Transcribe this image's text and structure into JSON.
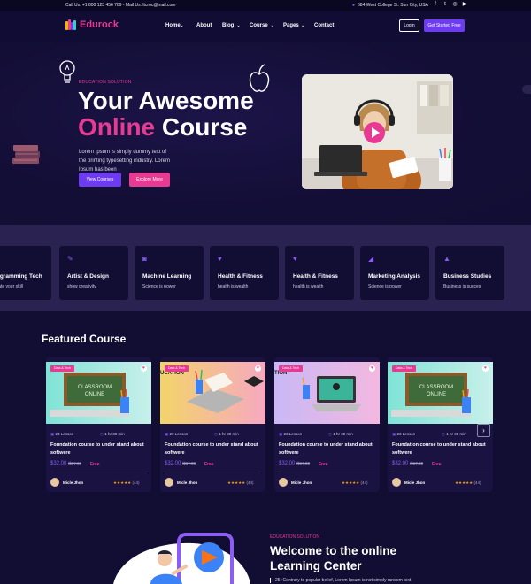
{
  "topbar": {
    "contact": "Call Us: +1 800 123 456 789 - Mail Us: ltcroc@mail.com",
    "address": "684 West College St. Sun City, USA",
    "social_icons": [
      "facebook-icon",
      "twitter-icon",
      "instagram-icon",
      "youtube-icon"
    ]
  },
  "header": {
    "logo_text": "Edurock",
    "nav": [
      "Home",
      "About",
      "Blog",
      "Course",
      "Pages",
      "Contact"
    ],
    "nav_dropdown": [
      true,
      false,
      true,
      true,
      true,
      false
    ],
    "login_label": "Login",
    "cta_label": "Get Started Free"
  },
  "hero": {
    "eyebrow": "EDUCATION SOLUTION",
    "title_line1": "Your Awesome",
    "title_pink": "Online",
    "title_rest": " Course",
    "description": "Lorem Ipsum is simply dummy text of the printing typesetting industry. Lorem Ipsum has been",
    "primary_button": "View Courses",
    "secondary_button": "Explore More"
  },
  "categories": [
    {
      "title": "Programming Tech",
      "subtitle": "Update your skill",
      "icon": "code-icon"
    },
    {
      "title": "Artist & Design",
      "subtitle": "show creativity",
      "icon": "brush-icon"
    },
    {
      "title": "Machine Learning",
      "subtitle": "Science is power",
      "icon": "robot-icon"
    },
    {
      "title": "Health & Fitness",
      "subtitle": "health is wealth",
      "icon": "heart-pulse-icon"
    },
    {
      "title": "Health & Fitness",
      "subtitle": "health is wealth",
      "icon": "heart-pulse-icon"
    },
    {
      "title": "Marketing Analysis",
      "subtitle": "Science is power",
      "icon": "megaphone-icon"
    },
    {
      "title": "Business Studies",
      "subtitle": "Business is succes",
      "icon": "chart-icon"
    }
  ],
  "featured": {
    "title": "Featured Course",
    "cards": [
      {
        "badge": "Data & Tech",
        "lessons": "23 Lesson",
        "duration": "1 hr 30 min",
        "title": "Foundation course to under stand about softwere",
        "price": "$32.00",
        "old_price": "/$67.00",
        "free": "Free",
        "author": "Micle Jhon",
        "rating_count": "(44)",
        "thumb": "classroom-online"
      },
      {
        "badge": "Data & Tech",
        "lessons": "23 Lesson",
        "duration": "1 hr 30 min",
        "title": "Foundation course to under stand about softwere",
        "price": "$32.00",
        "old_price": "/$67.00",
        "free": "Free",
        "author": "Micle Jhon",
        "rating_count": "(44)",
        "thumb": "education-book"
      },
      {
        "badge": "Data & Tech",
        "lessons": "23 Lesson",
        "duration": "1 hr 30 min",
        "title": "Foundation course to under stand about softwere",
        "price": "$32.00",
        "old_price": "/$67.00",
        "free": "Free",
        "author": "Micle Jhon",
        "rating_count": "(44)",
        "thumb": "education-laptop"
      },
      {
        "badge": "Data & Tech",
        "lessons": "23 Lesson",
        "duration": "1 hr 30 min",
        "title": "Foundation course to under stand about softwere",
        "price": "$32.00",
        "old_price": "/$67.00",
        "free": "Free",
        "author": "Micle Jhon",
        "rating_count": "(44)",
        "thumb": "classroom-online"
      }
    ],
    "thumb_words": {
      "classroom": "CLASSROOM ONLINE",
      "education": "UCATION",
      "education2": "TION"
    }
  },
  "welcome": {
    "eyebrow": "EDUCATION SOLUTION",
    "title": "Welcome to the online Learning Center",
    "description": "25+Contrary to popular belief, Lorem Ipsum is not simply random text"
  },
  "colors": {
    "accent_purple": "#6d3cf0",
    "accent_pink": "#e63a93",
    "bg": "#120d33",
    "star": "#f59e0b"
  }
}
